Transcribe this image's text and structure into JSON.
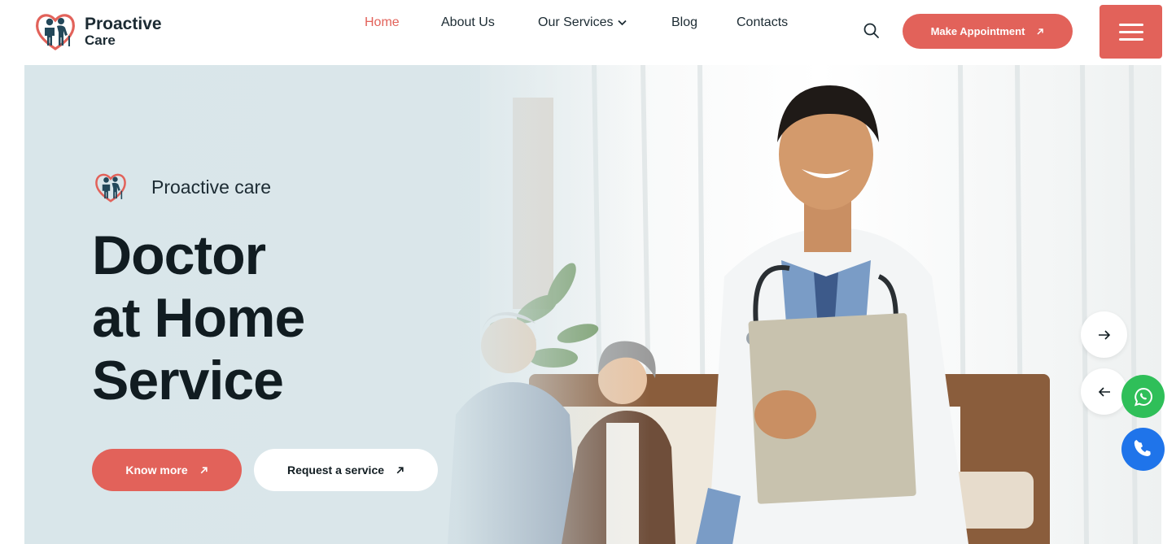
{
  "brand": {
    "name_line1": "Proactive",
    "name_line2": "Care",
    "heart_color": "#e2625a",
    "figure_color": "#23485a"
  },
  "nav": {
    "items": [
      {
        "label": "Home",
        "active": true
      },
      {
        "label": "About Us",
        "active": false
      },
      {
        "label": "Our Services",
        "active": false,
        "has_dropdown": true
      },
      {
        "label": "Blog",
        "active": false
      },
      {
        "label": "Contacts",
        "active": false
      }
    ]
  },
  "header": {
    "search_icon": "search-icon",
    "cta_label": "Make Appointment",
    "menu_icon": "hamburger-icon"
  },
  "hero": {
    "tag_label": "Proactive care",
    "headline_line1": "Doctor",
    "headline_line2": "at Home",
    "headline_line3": "Service",
    "primary_button": "Know more",
    "secondary_button": "Request a service"
  },
  "floating": {
    "whatsapp_icon": "whatsapp-icon",
    "phone_icon": "phone-icon"
  },
  "colors": {
    "accent": "#e2625a",
    "text_dark": "#111c21",
    "whatsapp": "#2fbf59",
    "phone": "#1f74ea",
    "hero_bg": "#dfe9ec"
  }
}
